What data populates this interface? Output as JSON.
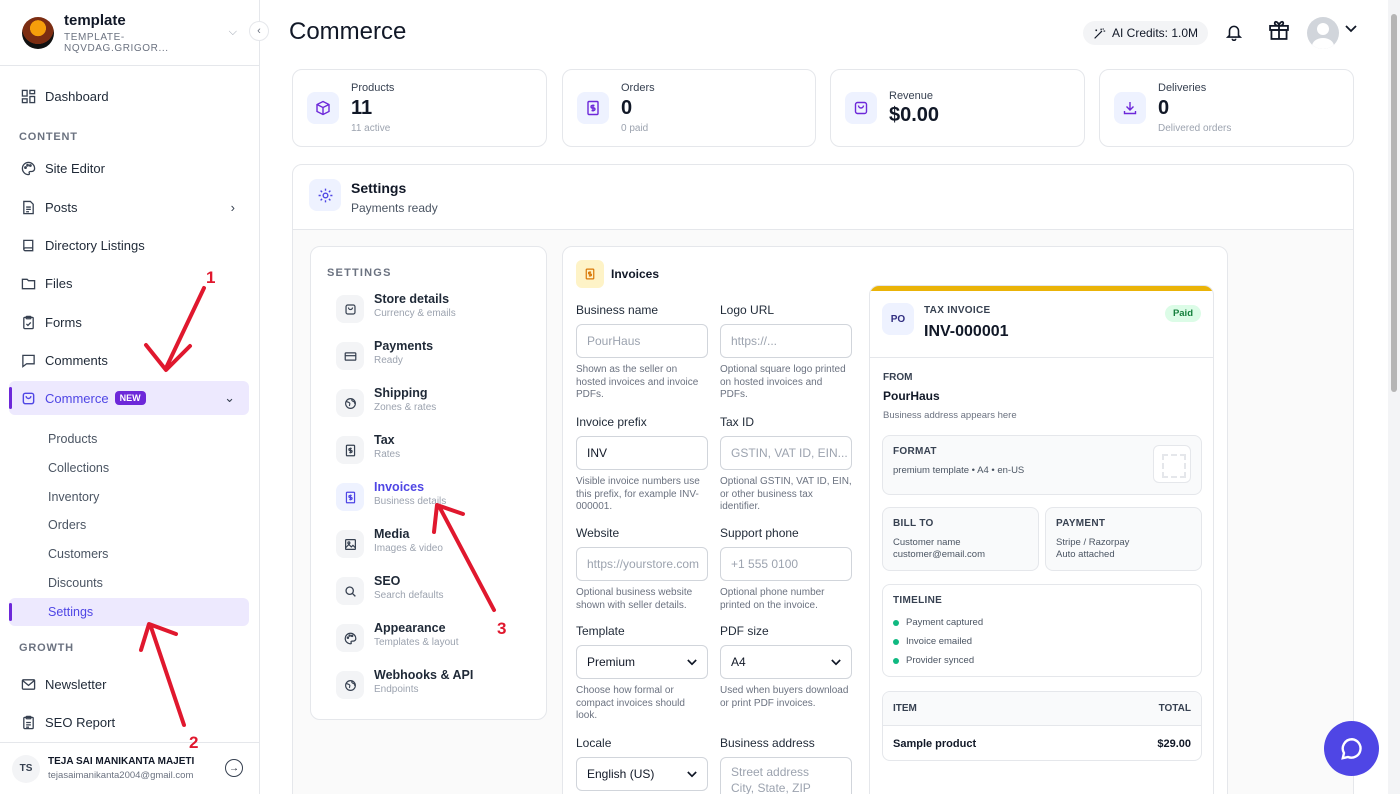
{
  "workspace": {
    "name": "template",
    "slug": "TEMPLATE-NQVDAG.GRIGOR..."
  },
  "sidebar": {
    "dashboard": "Dashboard",
    "content_label": "CONTENT",
    "site_editor": "Site Editor",
    "posts": "Posts",
    "directory": "Directory Listings",
    "files": "Files",
    "forms": "Forms",
    "comments": "Comments",
    "commerce": "Commerce",
    "commerce_badge": "NEW",
    "commerce_sub": [
      "Products",
      "Collections",
      "Inventory",
      "Orders",
      "Customers",
      "Discounts",
      "Settings"
    ],
    "growth_label": "GROWTH",
    "newsletter": "Newsletter",
    "seo_report": "SEO Report"
  },
  "user": {
    "initials": "TS",
    "name": "TEJA SAI MANIKANTA MAJETI",
    "email": "tejasaimanikanta2004@gmail.com"
  },
  "header": {
    "title": "Commerce",
    "credits": "AI Credits: 1.0M"
  },
  "stats": [
    {
      "label": "Products",
      "value": "11",
      "sub": "11 active"
    },
    {
      "label": "Orders",
      "value": "0",
      "sub": "0 paid"
    },
    {
      "label": "Revenue",
      "value": "$0.00",
      "sub": ""
    },
    {
      "label": "Deliveries",
      "value": "0",
      "sub": "Delivered orders"
    }
  ],
  "settings": {
    "title": "Settings",
    "subtitle": "Payments ready",
    "nav_label": "SETTINGS",
    "nav": [
      {
        "title": "Store details",
        "sub": "Currency & emails"
      },
      {
        "title": "Payments",
        "sub": "Ready"
      },
      {
        "title": "Shipping",
        "sub": "Zones & rates"
      },
      {
        "title": "Tax",
        "sub": "Rates"
      },
      {
        "title": "Invoices",
        "sub": "Business details"
      },
      {
        "title": "Media",
        "sub": "Images & video"
      },
      {
        "title": "SEO",
        "sub": "Search defaults"
      },
      {
        "title": "Appearance",
        "sub": "Templates & layout"
      },
      {
        "title": "Webhooks & API",
        "sub": "Endpoints"
      }
    ]
  },
  "invoices": {
    "title": "Invoices",
    "fields": {
      "business_name": {
        "label": "Business name",
        "placeholder": "PourHaus",
        "help": "Shown as the seller on hosted invoices and invoice PDFs."
      },
      "logo_url": {
        "label": "Logo URL",
        "placeholder": "https://...",
        "help": "Optional square logo printed on hosted invoices and PDFs."
      },
      "invoice_prefix": {
        "label": "Invoice prefix",
        "value": "INV",
        "help": "Visible invoice numbers use this prefix, for example INV-000001."
      },
      "tax_id": {
        "label": "Tax ID",
        "placeholder": "GSTIN, VAT ID, EIN...",
        "help": "Optional GSTIN, VAT ID, EIN, or other business tax identifier."
      },
      "website": {
        "label": "Website",
        "placeholder": "https://yourstore.com",
        "help": "Optional business website shown with seller details."
      },
      "support_phone": {
        "label": "Support phone",
        "placeholder": "+1 555 0100",
        "help": "Optional phone number printed on the invoice."
      },
      "template": {
        "label": "Template",
        "value": "Premium",
        "help": "Choose how formal or compact invoices should look."
      },
      "pdf_size": {
        "label": "PDF size",
        "value": "A4",
        "help": "Used when buyers download or print PDF invoices."
      },
      "locale": {
        "label": "Locale",
        "value": "English (US)"
      },
      "business_address": {
        "label": "Business address",
        "placeholder_1": "Street address",
        "placeholder_2": "City, State, ZIP"
      }
    },
    "preview": {
      "logo": "PO",
      "kicker": "TAX INVOICE",
      "number": "INV-000001",
      "status": "Paid",
      "from_label": "FROM",
      "from_name": "PourHaus",
      "from_address": "Business address appears here",
      "format_label": "FORMAT",
      "format_value": "premium template • A4 • en-US",
      "bill_to_label": "BILL TO",
      "bill_to_name": "Customer name",
      "bill_to_email": "customer@email.com",
      "payment_label": "PAYMENT",
      "payment_method": "Stripe / Razorpay",
      "payment_state": "Auto attached",
      "timeline_label": "TIMELINE",
      "timeline": [
        "Payment captured",
        "Invoice emailed",
        "Provider synced"
      ],
      "item_header": "ITEM",
      "total_header": "TOTAL",
      "item_name": "Sample product",
      "item_total": "$29.00"
    }
  },
  "annotations": [
    "1",
    "2",
    "3"
  ],
  "colors": {
    "accent": "#4f46e5",
    "accent_bg": "#ede9fe",
    "annotation": "#e0182e",
    "invoice_bar": "#eab308",
    "paid": "#15803d"
  }
}
